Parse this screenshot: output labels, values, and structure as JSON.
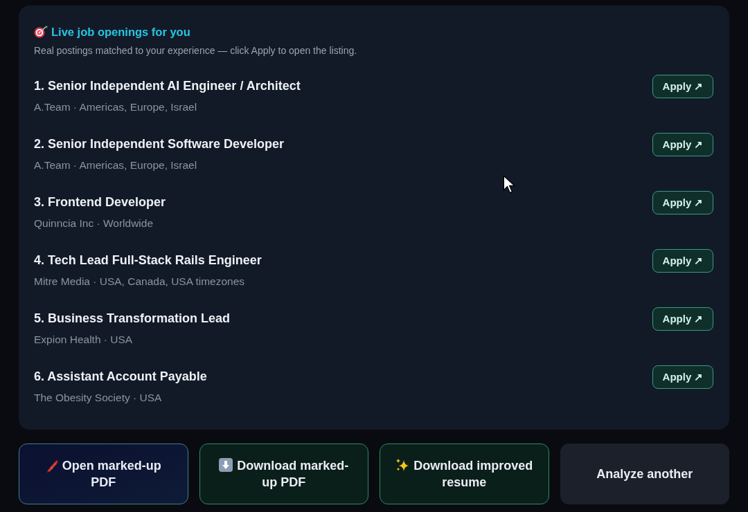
{
  "section": {
    "title": "Live job openings for you",
    "subtitle": "Real postings matched to your experience — click Apply to open the listing."
  },
  "jobs": [
    {
      "title": "1. Senior Independent AI Engineer / Architect",
      "meta": "A.Team · Americas, Europe, Israel",
      "action": "Apply ↗"
    },
    {
      "title": "2. Senior Independent Software Developer",
      "meta": "A.Team · Americas, Europe, Israel",
      "action": "Apply ↗"
    },
    {
      "title": "3. Frontend Developer",
      "meta": "Quinncia Inc · Worldwide",
      "action": "Apply ↗"
    },
    {
      "title": "4. Tech Lead Full-Stack Rails Engineer",
      "meta": "Mitre Media · USA, Canada, USA timezones",
      "action": "Apply ↗"
    },
    {
      "title": "5. Business Transformation Lead",
      "meta": "Expion Health · USA",
      "action": "Apply ↗"
    },
    {
      "title": "6. Assistant Account Payable",
      "meta": "The Obesity Society · USA",
      "action": "Apply ↗"
    }
  ],
  "actions": [
    {
      "kind": "open",
      "label": "Open marked-up PDF"
    },
    {
      "kind": "download",
      "label": "Download marked-up PDF"
    },
    {
      "kind": "improve",
      "label": "Download improved resume"
    },
    {
      "kind": "reset",
      "label": "Analyze another"
    }
  ]
}
